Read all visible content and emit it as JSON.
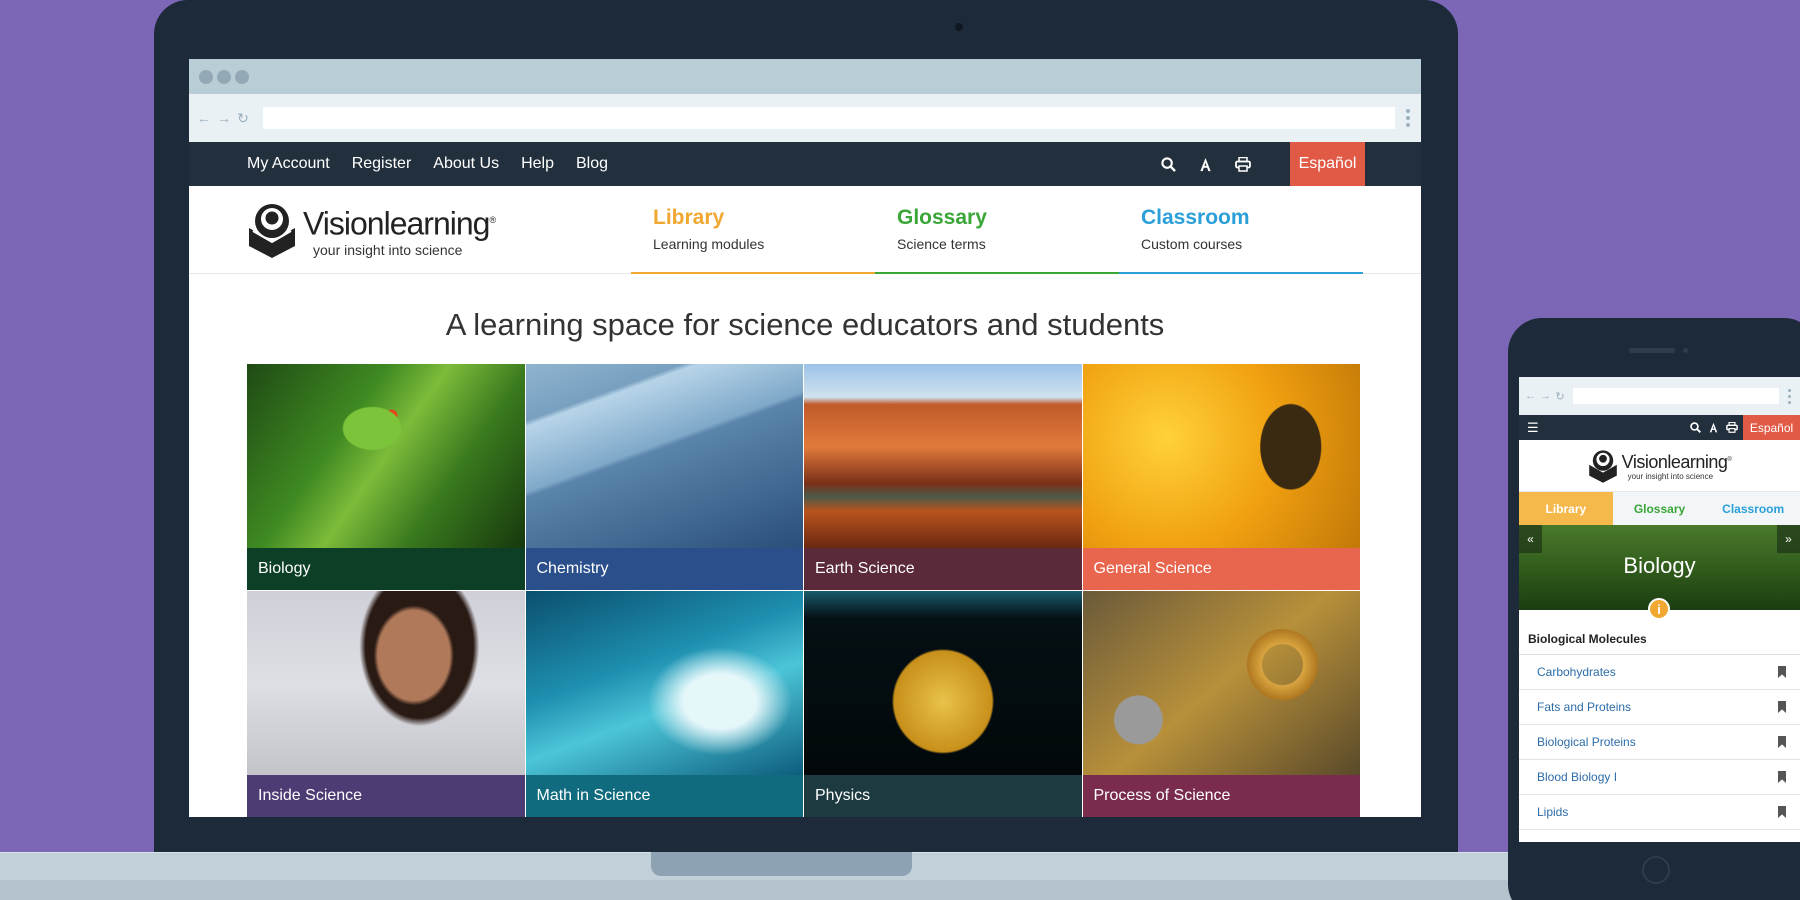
{
  "browser": {
    "back": "←",
    "forward": "→",
    "reload": "↻",
    "url": ""
  },
  "topbar": {
    "links": [
      "My Account",
      "Register",
      "About Us",
      "Help",
      "Blog"
    ],
    "espanol": "Español"
  },
  "logo": {
    "name": "Visionlearning",
    "registered": "®",
    "tagline": "your insight into science"
  },
  "main_nav": [
    {
      "title": "Library",
      "subtitle": "Learning modules",
      "color": "#f0a830"
    },
    {
      "title": "Glossary",
      "subtitle": "Science terms",
      "color": "#3aa637"
    },
    {
      "title": "Classroom",
      "subtitle": "Custom courses",
      "color": "#2a9fd8"
    }
  ],
  "hero": {
    "title": "A learning space for science educators and students"
  },
  "tiles": [
    {
      "label": "Biology",
      "color": "#0d3f26"
    },
    {
      "label": "Chemistry",
      "color": "#2b4f8a"
    },
    {
      "label": "Earth Science",
      "color": "#5a2a3a"
    },
    {
      "label": "General Science",
      "color": "#e7664d"
    },
    {
      "label": "Inside Science",
      "color": "#4d3b73"
    },
    {
      "label": "Math in Science",
      "color": "#0f6b7d"
    },
    {
      "label": "Physics",
      "color": "#1d3a40"
    },
    {
      "label": "Process of Science",
      "color": "#7a2c4e"
    }
  ],
  "phone": {
    "espanol": "Español",
    "tabs": [
      "Library",
      "Glossary",
      "Classroom"
    ],
    "hero_title": "Biology",
    "prev": "«",
    "next": "»",
    "info": "i",
    "section_title": "Biological Molecules",
    "list": [
      "Carbohydrates",
      "Fats and Proteins",
      "Biological Proteins",
      "Blood Biology I",
      "Lipids"
    ]
  }
}
